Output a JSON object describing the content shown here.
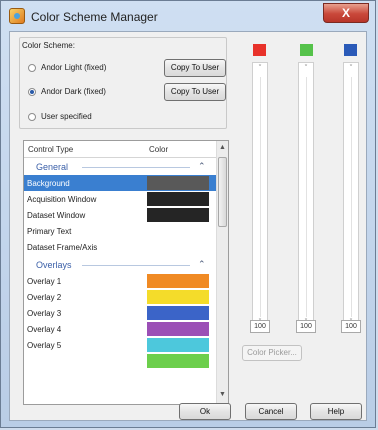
{
  "window": {
    "title": "Color Scheme Manager",
    "close": "X"
  },
  "scheme": {
    "legend": "Color Scheme:",
    "options": [
      {
        "label": "Andor Light (fixed)",
        "selected": false
      },
      {
        "label": "Andor Dark (fixed)",
        "selected": true
      },
      {
        "label": "User specified",
        "selected": false
      }
    ],
    "copy_label": "Copy To User"
  },
  "table": {
    "headers": [
      "Control Type",
      "Color"
    ],
    "groups": [
      {
        "name": "General",
        "rows": [
          {
            "label": "Background",
            "color": "#595959",
            "selected": true
          },
          {
            "label": "Acquisition Window",
            "color": "#252525"
          },
          {
            "label": "Dataset Window",
            "color": "#252525"
          },
          {
            "label": "Primary Text",
            "color": null
          },
          {
            "label": "Dataset Frame/Axis",
            "color": null
          }
        ]
      },
      {
        "name": "Overlays",
        "rows": [
          {
            "label": "Overlay 1",
            "color": "#f08a24"
          },
          {
            "label": "Overlay 2",
            "color": "#f4dc2a"
          },
          {
            "label": "Overlay 3",
            "color": "#3b64c8"
          },
          {
            "label": "Overlay 4",
            "color": "#9b4fb6"
          },
          {
            "label": "Overlay 5",
            "color": "#4dc8dc"
          },
          {
            "label": "",
            "color": "#6ccf4c"
          }
        ]
      }
    ]
  },
  "channels": [
    {
      "name": "red",
      "color": "#e8322a",
      "value": "100"
    },
    {
      "name": "green",
      "color": "#55c24a",
      "value": "100"
    },
    {
      "name": "blue",
      "color": "#2a5ab8",
      "value": "100"
    }
  ],
  "color_picker_label": "Color Picker...",
  "buttons": {
    "ok": "Ok",
    "cancel": "Cancel",
    "help": "Help"
  }
}
